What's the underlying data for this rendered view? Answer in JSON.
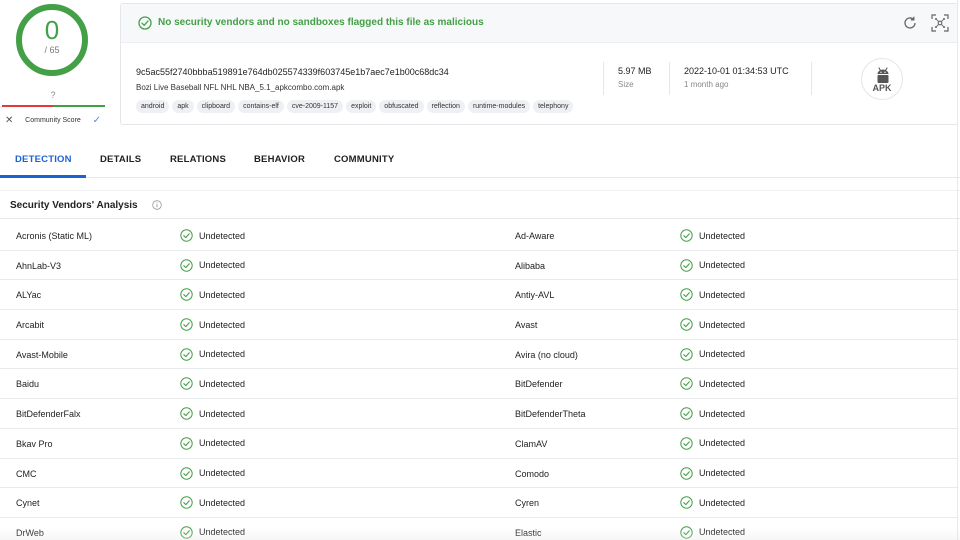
{
  "score": {
    "detections": "0",
    "total": "/ 65",
    "community_value": "?",
    "community_label": "Community Score",
    "ring_color": "#43a047"
  },
  "file": {
    "banner_text": "No security vendors and no sandboxes flagged this file as malicious",
    "hash": "9c5ac55f2740bbba519891e764db025574339f603745e1b7aec7e1b00c68dc34",
    "name": "Bozi Live Baseball NFL NHL NBA_5.1_apkcombo.com.apk",
    "tags": [
      "android",
      "apk",
      "clipboard",
      "contains-elf",
      "cve-2009-1157",
      "exploit",
      "obfuscated",
      "reflection",
      "runtime-modules",
      "telephony"
    ],
    "size": "5.97 MB",
    "size_label": "Size",
    "date": "2022-10-01 01:34:53 UTC",
    "date_relative": "1 month ago",
    "type_badge": "APK"
  },
  "tabs": [
    {
      "label": "DETECTION",
      "active": true
    },
    {
      "label": "DETAILS",
      "active": false
    },
    {
      "label": "RELATIONS",
      "active": false
    },
    {
      "label": "BEHAVIOR",
      "active": false
    },
    {
      "label": "COMMUNITY",
      "active": false
    }
  ],
  "analysis": {
    "title": "Security Vendors' Analysis",
    "rows": [
      {
        "left": "Acronis (Static ML)",
        "left_status": "Undetected",
        "right": "Ad-Aware",
        "right_status": "Undetected"
      },
      {
        "left": "AhnLab-V3",
        "left_status": "Undetected",
        "right": "Alibaba",
        "right_status": "Undetected"
      },
      {
        "left": "ALYac",
        "left_status": "Undetected",
        "right": "Antiy-AVL",
        "right_status": "Undetected"
      },
      {
        "left": "Arcabit",
        "left_status": "Undetected",
        "right": "Avast",
        "right_status": "Undetected"
      },
      {
        "left": "Avast-Mobile",
        "left_status": "Undetected",
        "right": "Avira (no cloud)",
        "right_status": "Undetected"
      },
      {
        "left": "Baidu",
        "left_status": "Undetected",
        "right": "BitDefender",
        "right_status": "Undetected"
      },
      {
        "left": "BitDefenderFalx",
        "left_status": "Undetected",
        "right": "BitDefenderTheta",
        "right_status": "Undetected"
      },
      {
        "left": "Bkav Pro",
        "left_status": "Undetected",
        "right": "ClamAV",
        "right_status": "Undetected"
      },
      {
        "left": "CMC",
        "left_status": "Undetected",
        "right": "Comodo",
        "right_status": "Undetected"
      },
      {
        "left": "Cynet",
        "left_status": "Undetected",
        "right": "Cyren",
        "right_status": "Undetected"
      },
      {
        "left": "DrWeb",
        "left_status": "Undetected",
        "right": "Elastic",
        "right_status": "Undetected"
      }
    ]
  },
  "colors": {
    "clean_green": "#43a047",
    "active_tab_blue": "#1a62d6"
  }
}
